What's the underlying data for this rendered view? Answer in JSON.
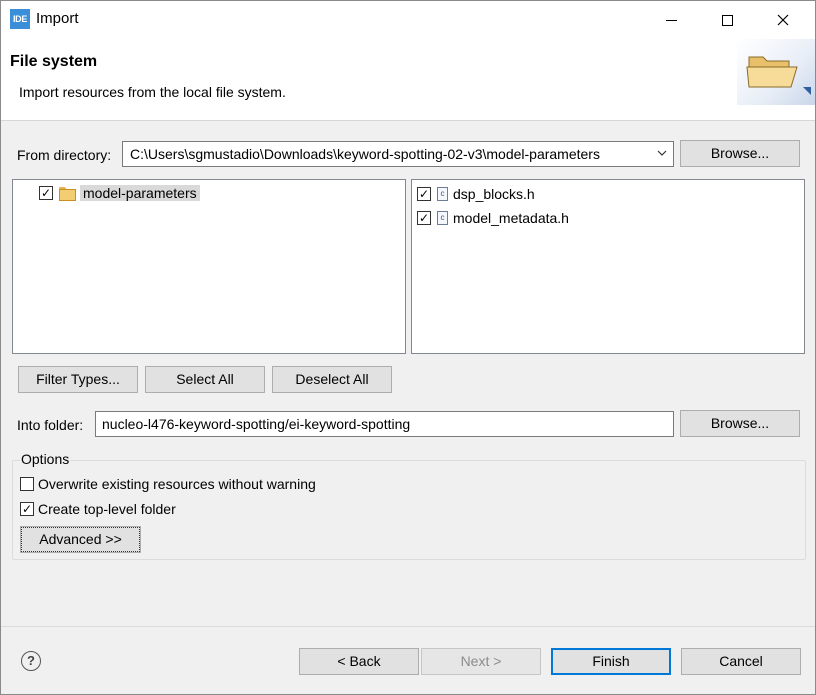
{
  "window": {
    "title": "Import",
    "app_icon_text": "IDE"
  },
  "header": {
    "title": "File system",
    "description": "Import resources from the local file system."
  },
  "from_directory": {
    "label": "From directory:",
    "value": "C:\\Users\\sgmustadio\\Downloads\\keyword-spotting-02-v3\\model-parameters",
    "browse_label": "Browse..."
  },
  "folders": [
    {
      "label": "model-parameters",
      "checked": true
    }
  ],
  "files": [
    {
      "label": "dsp_blocks.h",
      "checked": true
    },
    {
      "label": "model_metadata.h",
      "checked": true
    }
  ],
  "selection_buttons": {
    "filter_types": "Filter Types...",
    "select_all": "Select All",
    "deselect_all": "Deselect All"
  },
  "into_folder": {
    "label": "Into folder:",
    "value": "nucleo-l476-keyword-spotting/ei-keyword-spotting",
    "browse_label": "Browse..."
  },
  "options": {
    "title": "Options",
    "overwrite_label": "Overwrite existing resources without warning",
    "overwrite_checked": false,
    "create_top_level_label": "Create top-level folder",
    "create_top_level_checked": true,
    "advanced_label": "Advanced >>"
  },
  "footer": {
    "back_label": "< Back",
    "next_label": "Next >",
    "finish_label": "Finish",
    "cancel_label": "Cancel"
  }
}
